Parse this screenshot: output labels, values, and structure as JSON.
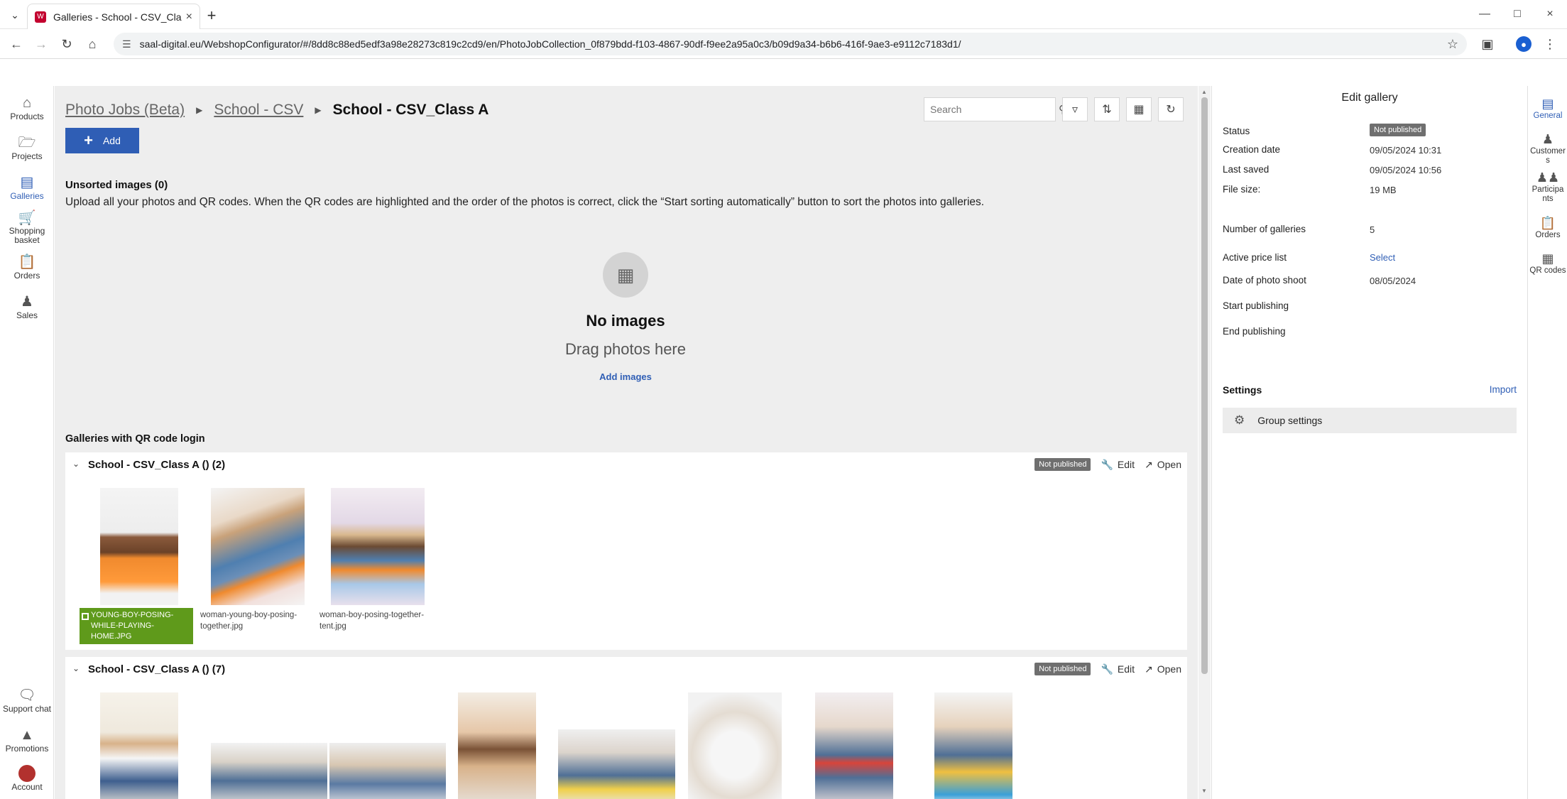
{
  "browser": {
    "tab_title": "Galleries - School - CSV_Class A",
    "favicon_text": "W",
    "url": "saal-digital.eu/WebshopConfigurator/#/8dd8c88ed5edf3a98e28273c819c2cd9/en/PhotoJobCollection_0f879bdd-f103-4867-90df-f9ee2a95a0c3/b09d9a34-b6b6-416f-9ae3-e9112c7183d1/"
  },
  "leftnav": {
    "items": [
      {
        "label": "Products",
        "icon": "home-icon"
      },
      {
        "label": "Projects",
        "icon": "folder-icon"
      },
      {
        "label": "Galleries",
        "icon": "gallery-icon"
      },
      {
        "label": "Shopping basket",
        "icon": "cart-icon"
      },
      {
        "label": "Orders",
        "icon": "orders-icon"
      },
      {
        "label": "Sales",
        "icon": "sales-icon"
      }
    ],
    "bottom": [
      {
        "label": "Support chat",
        "icon": "chat-icon"
      },
      {
        "label": "Promotions",
        "icon": "bell-icon"
      },
      {
        "label": "Account",
        "icon": "avatar"
      }
    ]
  },
  "main": {
    "breadcrumb": [
      "Photo Jobs (Beta)",
      "School - CSV",
      "School - CSV_Class A"
    ],
    "search_placeholder": "Search",
    "add_label": "Add",
    "unsorted_title": "Unsorted images (0)",
    "upload_text": "Upload all your photos and QR codes. When the QR codes are highlighted and the order of the photos is correct, click the “Start sorting automatically” button to sort the photos into galleries.",
    "empty_title": "No images",
    "empty_sub": "Drag photos here",
    "add_images": "Add images",
    "galleries_title": "Galleries with QR code login",
    "galleries": [
      {
        "title": "School - CSV_Class A () (2)",
        "status": "Not published",
        "edit": "Edit",
        "open": "Open",
        "images": [
          {
            "label": "YOUNG-BOY-POSING-WHILE-PLAYING-HOME.JPG",
            "qr": true
          },
          {
            "label": "woman-young-boy-posing-together.jpg",
            "qr": false
          },
          {
            "label": "woman-boy-posing-together-tent.jpg",
            "qr": false
          }
        ]
      },
      {
        "title": "School - CSV_Class A () (7)",
        "status": "Not published",
        "edit": "Edit",
        "open": "Open"
      }
    ]
  },
  "panel": {
    "title": "Edit gallery",
    "fields": {
      "status_label": "Status",
      "status_value": "Not published",
      "creation_label": "Creation date",
      "creation_value": "09/05/2024 10:31",
      "saved_label": "Last saved",
      "saved_value": "09/05/2024 10:56",
      "size_label": "File size:",
      "size_value": "19 MB",
      "galleries_label": "Number of galleries",
      "galleries_value": "5",
      "price_label": "Active price list",
      "price_value": "Select",
      "shoot_label": "Date of photo shoot",
      "shoot_value": "08/05/2024",
      "start_label": "Start publishing",
      "end_label": "End publishing"
    },
    "settings_title": "Settings",
    "import": "Import",
    "group_settings": "Group settings"
  },
  "rnav": {
    "items": [
      {
        "label": "General"
      },
      {
        "label": "Customer s"
      },
      {
        "label": "Participa nts"
      },
      {
        "label": "Orders"
      },
      {
        "label": "QR codes"
      }
    ]
  },
  "colors": {
    "accent": "#2f5eb5",
    "qr_green": "#5f9a1b",
    "badge_gray": "#6f6f6f",
    "brand_red": "#c3002f"
  }
}
